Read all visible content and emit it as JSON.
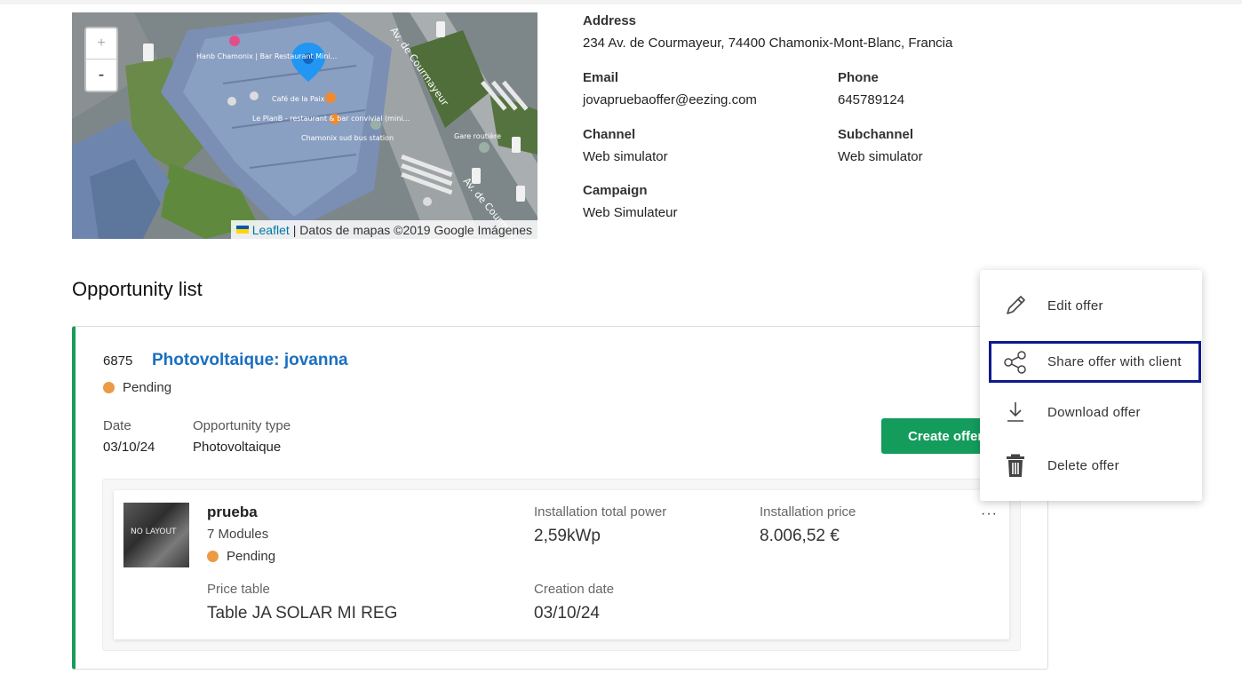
{
  "map": {
    "zoom_in": "+",
    "zoom_out": "-",
    "attribution_link": "Leaflet",
    "attribution_text": "| Datos de mapas ©2019 Google Imágenes",
    "labels": {
      "restaurant": "Hanb Chamonix | Bar Restaurant Mini...",
      "cafe": "Café de la Paix",
      "planb": "Le PlanB - restaurant & bar convivial (mini...",
      "bus_station": "Chamonix sud bus station",
      "gare": "Gare routière",
      "avenue1": "Av. de Courmayeur",
      "avenue2": "Av. de Courmayeur"
    }
  },
  "client": {
    "address_label": "Address",
    "address_value": "234 Av. de Courmayeur, 74400 Chamonix-Mont-Blanc, Francia",
    "email_label": "Email",
    "email_value": "jovapruebaoffer@eezing.com",
    "phone_label": "Phone",
    "phone_value": "645789124",
    "channel_label": "Channel",
    "channel_value": "Web simulator",
    "subchannel_label": "Subchannel",
    "subchannel_value": "Web simulator",
    "campaign_label": "Campaign",
    "campaign_value": "Web Simulateur"
  },
  "opportunities": {
    "section_title": "Opportunity list",
    "item": {
      "id": "6875",
      "title": "Photovoltaique: jovanna",
      "status": "Pending",
      "date_label": "Date",
      "date_value": "03/10/24",
      "type_label": "Opportunity type",
      "type_value": "Photovoltaique",
      "create_button": "Create offer",
      "offer": {
        "thumb_text": "NO LAYOUT",
        "name": "prueba",
        "modules": "7 Modules",
        "status": "Pending",
        "power_label": "Installation total power",
        "power_value": "2,59kWp",
        "price_label": "Installation price",
        "price_value": "8.006,52 €",
        "table_label": "Price table",
        "table_value": "Table JA SOLAR MI REG",
        "creation_label": "Creation date",
        "creation_value": "03/10/24",
        "more": "···"
      }
    }
  },
  "menu": {
    "edit": "Edit offer",
    "share": "Share offer with client",
    "download": "Download offer",
    "delete": "Delete offer"
  },
  "colors": {
    "accent_green": "#139c5c",
    "link_blue": "#1a6fc2",
    "pending": "#ec9a45",
    "focus": "#0d1a8c"
  }
}
